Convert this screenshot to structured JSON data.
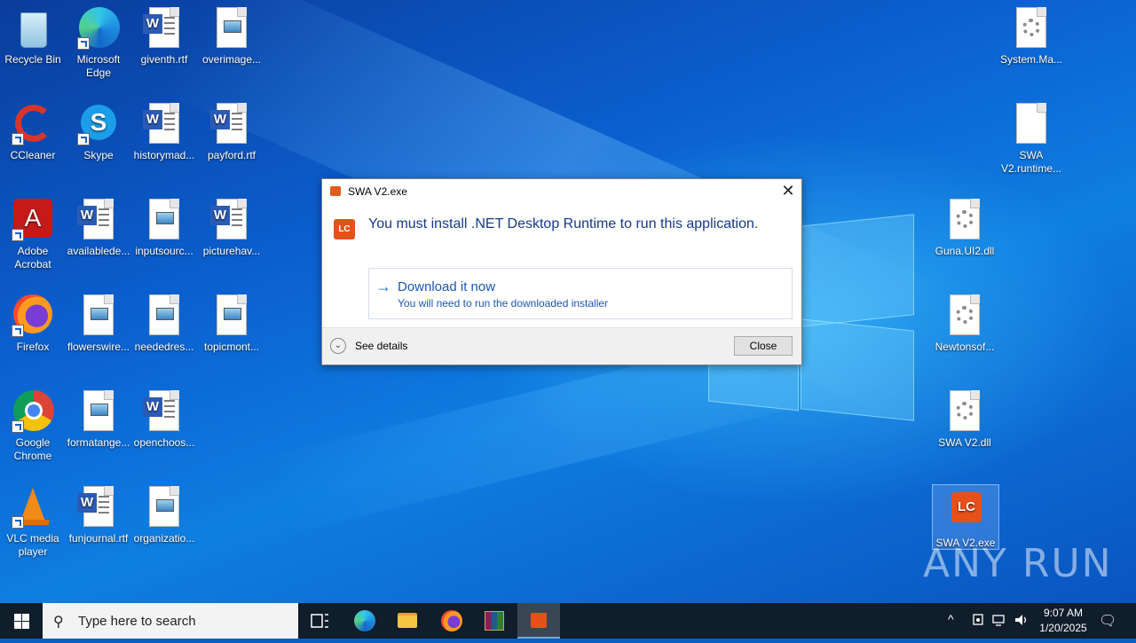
{
  "desktop": {
    "icons_left": [
      {
        "label": "Recycle Bin",
        "kind": "recycle"
      },
      {
        "label": "Microsoft Edge",
        "kind": "edge"
      },
      {
        "label": "giventh.rtf",
        "kind": "word"
      },
      {
        "label": "overimage...",
        "kind": "image"
      },
      {
        "label": "CCleaner",
        "kind": "ccleaner"
      },
      {
        "label": "Skype",
        "kind": "skype"
      },
      {
        "label": "historymad...",
        "kind": "word"
      },
      {
        "label": "payford.rtf",
        "kind": "word"
      },
      {
        "label": "Adobe Acrobat",
        "kind": "acrobat"
      },
      {
        "label": "availablede...",
        "kind": "word"
      },
      {
        "label": "inputsourc...",
        "kind": "image"
      },
      {
        "label": "picturehav...",
        "kind": "word"
      },
      {
        "label": "Firefox",
        "kind": "firefox"
      },
      {
        "label": "flowerswire...",
        "kind": "image"
      },
      {
        "label": "neededres...",
        "kind": "image"
      },
      {
        "label": "topicmont...",
        "kind": "image"
      },
      {
        "label": "Google Chrome",
        "kind": "chrome"
      },
      {
        "label": "formatange...",
        "kind": "image"
      },
      {
        "label": "openchoos...",
        "kind": "word"
      },
      {
        "label": "VLC media player",
        "kind": "vlc"
      },
      {
        "label": "funjournal.rtf",
        "kind": "word"
      },
      {
        "label": "organizatio...",
        "kind": "image"
      }
    ],
    "icons_right": [
      {
        "label": "System.Ma...",
        "kind": "dll"
      },
      {
        "label": "SWA V2.runtime...",
        "kind": "blank"
      },
      {
        "label": "Guna.UI2.dll",
        "kind": "dll"
      },
      {
        "label": "Newtonsof...",
        "kind": "dll"
      },
      {
        "label": "SWA V2.dll",
        "kind": "dll"
      },
      {
        "label": "SWA V2.exe",
        "kind": "lc"
      }
    ]
  },
  "dialog": {
    "title": "SWA V2.exe",
    "icon_text": "LC",
    "close_glyph": "✕",
    "message": "You must install .NET Desktop Runtime to run this application.",
    "command_link": {
      "arrow": "→",
      "title": "Download it now",
      "subtitle": "You will need to run the downloaded installer"
    },
    "details_label": "See details",
    "details_glyph": "⌄",
    "close_button": "Close"
  },
  "watermark": "ANY RUN",
  "taskbar": {
    "search_placeholder": "Type here to search",
    "search_glyph": "⚲",
    "time": "9:07 AM",
    "date": "1/20/2025",
    "tray_chevron": "^",
    "notifications_glyph": "🗨"
  },
  "colors": {
    "dialog_message": "#13398c",
    "link": "#1d55b3",
    "lc_orange": "#e8501a",
    "taskbar": "#101d2a"
  }
}
